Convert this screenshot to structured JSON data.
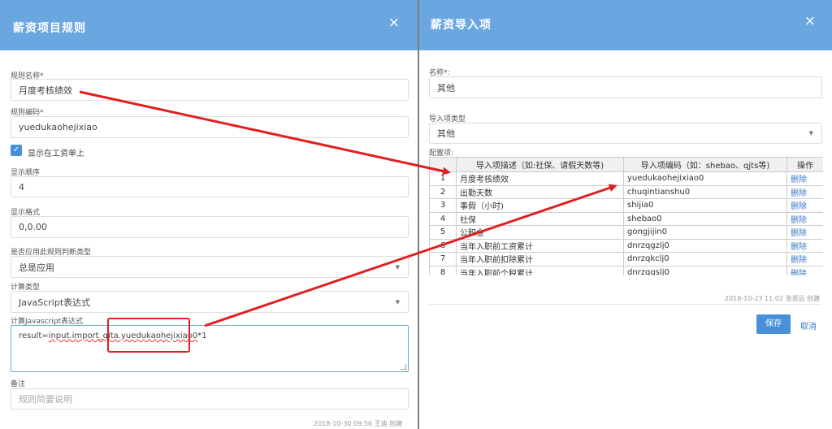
{
  "left": {
    "title": "薪资项目规则",
    "close": "×",
    "rule_name_label": "规则名称*",
    "rule_name_value": "月度考核绩效",
    "rule_code_label": "规则编码*",
    "rule_code_value": "yuedukaohejixiao",
    "show_on_payslip_label": "显示在工资单上",
    "show_on_payslip_checked": true,
    "display_order_label": "显示顺序",
    "display_order_value": "4",
    "display_format_label": "显示格式",
    "display_format_value": "0,0.00",
    "apply_type_label": "是否应用此规则判断类型",
    "apply_type_value": "总是应用",
    "calc_type_label": "计算类型",
    "calc_type_value": "JavaScript表达式",
    "js_expr_label": "计算Javascript表达式",
    "js_expr_prefix": "result=",
    "js_expr_underlined": "input.import_qita.yuedukaohejixiao0",
    "js_expr_suffix": "*1",
    "remark_label": "备注",
    "remark_placeholder": "规则简要说明",
    "footer": "2018-10-30 09:56 王迪 创建"
  },
  "right": {
    "title": "薪资导入项",
    "close": "×",
    "name_label": "名称*:",
    "name_value": "其他",
    "type_label": "导入项类型",
    "type_value": "其他",
    "config_label": "配置项:",
    "table": {
      "headers": [
        "",
        "导入项描述（如:社保、请假天数等)",
        "导入项编码（如：shebao、qjts等)",
        "操作"
      ],
      "rows": [
        {
          "num": "1",
          "desc": "月度考核绩效",
          "code": "yuedukaohejixiao0",
          "op": "删除"
        },
        {
          "num": "2",
          "desc": "出勤天数",
          "code": "chuqintianshu0",
          "op": "删除"
        },
        {
          "num": "3",
          "desc": "事假（小时)",
          "code": "shijia0",
          "op": "删除"
        },
        {
          "num": "4",
          "desc": "社保",
          "code": "shebao0",
          "op": "删除"
        },
        {
          "num": "5",
          "desc": "公积金",
          "code": "gongjijin0",
          "op": "删除"
        },
        {
          "num": "6",
          "desc": "当年入职前工资累计",
          "code": "dnrzqgzlj0",
          "op": "删除"
        },
        {
          "num": "7",
          "desc": "当年入职前扣除累计",
          "code": "dnrzqkclj0",
          "op": "删除"
        },
        {
          "num": "8",
          "desc": "当年入职前个税累计",
          "code": "dnrzqgslj0",
          "op": "删除"
        }
      ]
    },
    "footer": "2018-10-23 11:02 张恩远 创建",
    "save_label": "保存",
    "cancel_label": "取消"
  },
  "colors": {
    "header": "#6aa7e0",
    "primary": "#4a90d9",
    "arrow": "#e02020"
  }
}
